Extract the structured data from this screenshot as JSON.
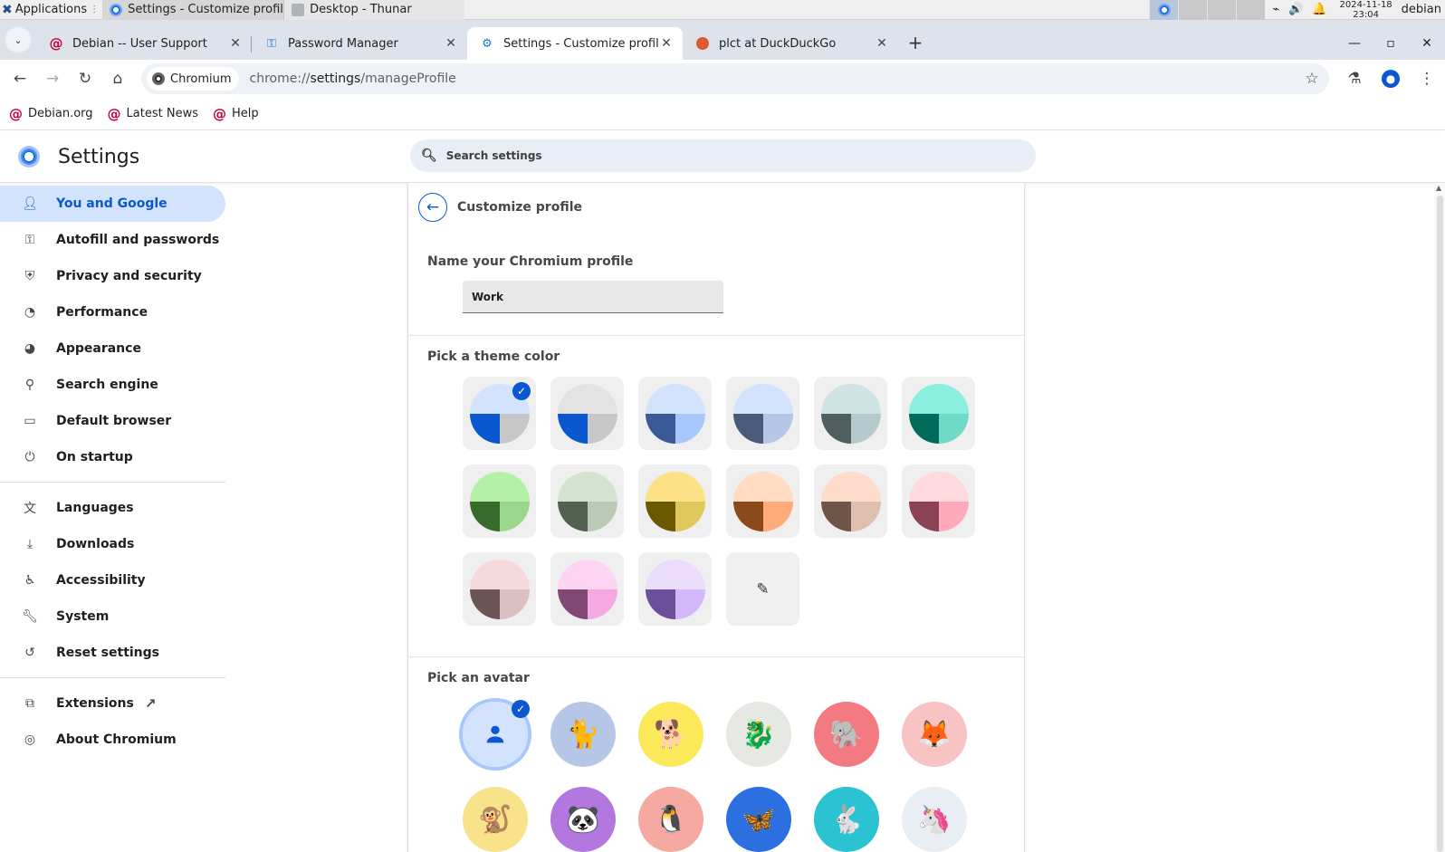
{
  "panel": {
    "apps_label": "Applications",
    "tasks": [
      {
        "label": "Settings - Customize profil...",
        "active": true
      },
      {
        "label": "Desktop - Thunar",
        "active": false
      }
    ],
    "clock_date": "2024-11-18",
    "clock_time": "23:04",
    "user": "debian"
  },
  "tabs": [
    {
      "title": "Debian -- User Support",
      "icon": "debian-swirl-icon"
    },
    {
      "title": "Password Manager",
      "icon": "key-icon"
    },
    {
      "title": "Settings - Customize profile",
      "icon": "gear-icon",
      "active": true
    },
    {
      "title": "plct at DuckDuckGo",
      "icon": "duckduckgo-icon"
    }
  ],
  "toolbar": {
    "chip_label": "Chromium",
    "url_scheme": "chrome://",
    "url_host": "settings",
    "url_path": "/manageProfile"
  },
  "bookmarks": [
    {
      "label": "Debian.org"
    },
    {
      "label": "Latest News"
    },
    {
      "label": "Help"
    }
  ],
  "settings": {
    "title": "Settings",
    "search_placeholder": "Search settings"
  },
  "sidebar": {
    "items": [
      {
        "label": "You and Google",
        "icon": "person-icon",
        "active": true
      },
      {
        "label": "Autofill and passwords",
        "icon": "key-icon"
      },
      {
        "label": "Privacy and security",
        "icon": "shield-icon"
      },
      {
        "label": "Performance",
        "icon": "speedometer-icon"
      },
      {
        "label": "Appearance",
        "icon": "palette-icon"
      },
      {
        "label": "Search engine",
        "icon": "search-icon"
      },
      {
        "label": "Default browser",
        "icon": "browser-window-icon"
      },
      {
        "label": "On startup",
        "icon": "power-icon"
      }
    ],
    "items2": [
      {
        "label": "Languages",
        "icon": "translate-icon"
      },
      {
        "label": "Downloads",
        "icon": "download-icon"
      },
      {
        "label": "Accessibility",
        "icon": "accessibility-icon"
      },
      {
        "label": "System",
        "icon": "wrench-icon"
      },
      {
        "label": "Reset settings",
        "icon": "reset-icon"
      }
    ],
    "items3": [
      {
        "label": "Extensions",
        "icon": "puzzle-icon"
      },
      {
        "label": "About Chromium",
        "icon": "chromium-icon"
      }
    ]
  },
  "profile": {
    "header": "Customize profile",
    "name_label": "Name your Chromium profile",
    "name_value": "Work",
    "theme_label": "Pick a theme color",
    "avatar_label": "Pick an avatar",
    "themes": [
      {
        "top": "#d3e3fd",
        "bl": "#0b57d0",
        "br": "#c7c7c7",
        "selected": true
      },
      {
        "top": "#e3e3e3",
        "bl": "#0b57d0",
        "br": "#c7c7c7"
      },
      {
        "top": "#d3e3fd",
        "bl": "#3b5998",
        "br": "#a8c7fa"
      },
      {
        "top": "#d3e3fd",
        "bl": "#4a5a7a",
        "br": "#b6c6e6"
      },
      {
        "top": "#cfe2e4",
        "bl": "#4f5f60",
        "br": "#b5cacc"
      },
      {
        "top": "#8af0dd",
        "bl": "#006b5d",
        "br": "#6fdac5"
      },
      {
        "top": "#b4f0a8",
        "bl": "#386a2c",
        "br": "#9bd88e"
      },
      {
        "top": "#d4e3d0",
        "bl": "#52604f",
        "br": "#bacbb5"
      },
      {
        "top": "#fde186",
        "bl": "#6b5800",
        "br": "#e0c75c"
      },
      {
        "top": "#ffdcc2",
        "bl": "#8c4a1b",
        "br": "#ffac7a"
      },
      {
        "top": "#ffdbcc",
        "bl": "#6e5548",
        "br": "#dfbfb0"
      },
      {
        "top": "#ffd9dd",
        "bl": "#8b4255",
        "br": "#ffaabb"
      },
      {
        "top": "#f6d9dc",
        "bl": "#6d5457",
        "br": "#dcbfc3"
      },
      {
        "top": "#fdd5f2",
        "bl": "#814875",
        "br": "#f5a9e3"
      },
      {
        "top": "#ebdcfc",
        "bl": "#6b4f9c",
        "br": "#d2b7fb"
      }
    ],
    "avatars": [
      {
        "name": "default-avatar",
        "bg": "#d3e3fd",
        "selected": true
      },
      {
        "name": "origami-cat-avatar",
        "bg": "#b6c6e6",
        "glyph": "🐈"
      },
      {
        "name": "origami-corgi-avatar",
        "bg": "#fbe95a",
        "glyph": "🐕"
      },
      {
        "name": "origami-dragon-avatar",
        "bg": "#e6e8e4",
        "glyph": "🐉"
      },
      {
        "name": "origami-elephant-avatar",
        "bg": "#f47a82",
        "glyph": "🐘"
      },
      {
        "name": "origami-fox-avatar",
        "bg": "#f7c3c3",
        "glyph": "🦊"
      },
      {
        "name": "origami-monkey-avatar",
        "bg": "#f8e28a",
        "glyph": "🐒"
      },
      {
        "name": "origami-panda-avatar",
        "bg": "#b377e0",
        "glyph": "🐼"
      },
      {
        "name": "origami-penguin-avatar",
        "bg": "#f5a9a0",
        "glyph": "🐧"
      },
      {
        "name": "origami-butterfly-avatar",
        "bg": "#2c6fe0",
        "glyph": "🦋"
      },
      {
        "name": "origami-rabbit-avatar",
        "bg": "#2bc2d2",
        "glyph": "🐇"
      },
      {
        "name": "origami-unicorn-avatar",
        "bg": "#e8eef3",
        "glyph": "🦄"
      }
    ]
  }
}
